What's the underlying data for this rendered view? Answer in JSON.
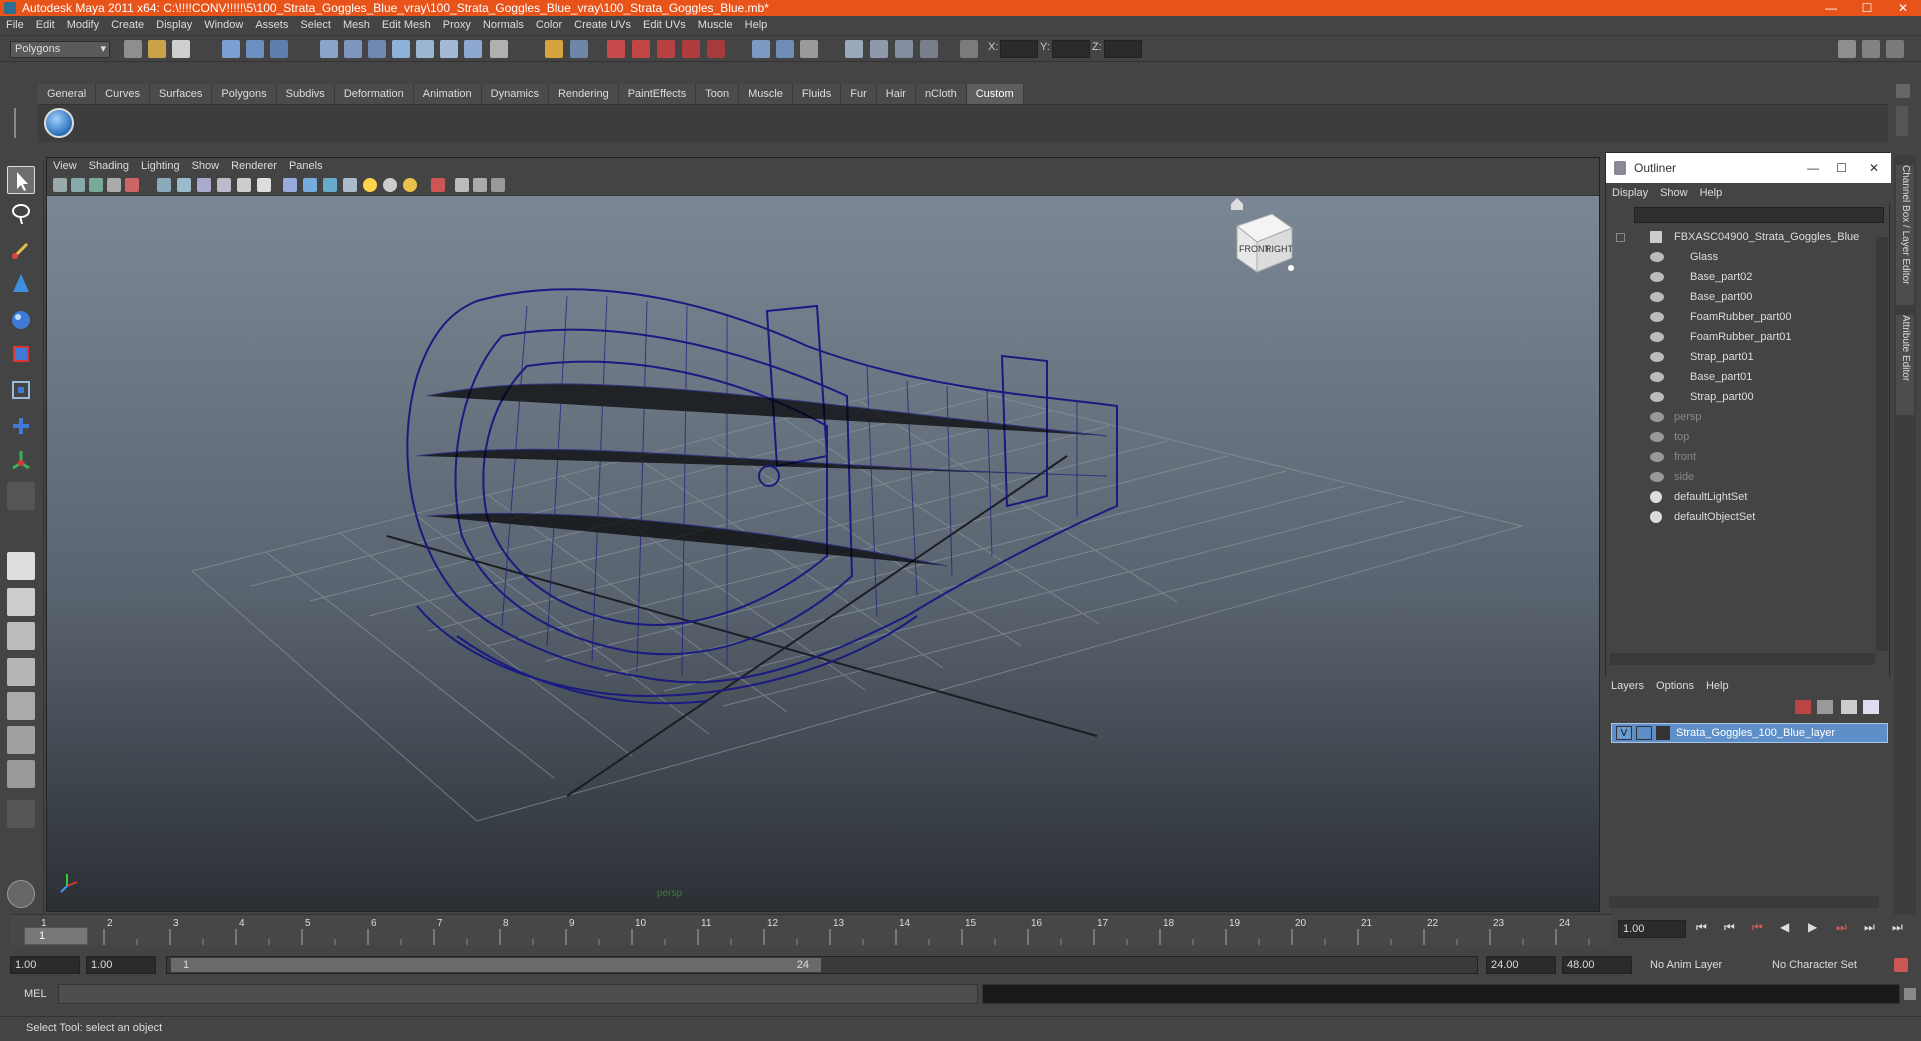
{
  "title": "Autodesk Maya 2011 x64: C:\\!!!!CONV!!!!!\\5\\100_Strata_Goggles_Blue_vray\\100_Strata_Goggles_Blue_vray\\100_Strata_Goggles_Blue.mb*",
  "window_controls": [
    "—",
    "☐",
    "✕"
  ],
  "menubar": [
    "File",
    "Edit",
    "Modify",
    "Create",
    "Display",
    "Window",
    "Assets",
    "Select",
    "Mesh",
    "Edit Mesh",
    "Proxy",
    "Normals",
    "Color",
    "Create UVs",
    "Edit UVs",
    "Muscle",
    "Help"
  ],
  "status_line": {
    "mode": "Polygons",
    "x_label": "X:",
    "y_label": "Y:",
    "z_label": "Z:"
  },
  "shelf_tabs": [
    "General",
    "Curves",
    "Surfaces",
    "Polygons",
    "Subdivs",
    "Deformation",
    "Animation",
    "Dynamics",
    "Rendering",
    "PaintEffects",
    "Toon",
    "Muscle",
    "Fluids",
    "Fur",
    "Hair",
    "nCloth",
    "Custom"
  ],
  "active_shelf": "Custom",
  "viewport_menu": [
    "View",
    "Shading",
    "Lighting",
    "Show",
    "Renderer",
    "Panels"
  ],
  "viewcube": {
    "front": "FRONT",
    "right": "RIGHT"
  },
  "viewport_label": "persp",
  "outliner": {
    "title": "Outliner",
    "menu": [
      "Display",
      "Show",
      "Help"
    ],
    "root": "FBXASC04900_Strata_Goggles_Blue",
    "children": [
      "Glass",
      "Base_part02",
      "Base_part00",
      "FoamRubber_part00",
      "FoamRubber_part01",
      "Strap_part01",
      "Base_part01",
      "Strap_part00"
    ],
    "cameras": [
      "persp",
      "top",
      "front",
      "side"
    ],
    "sets": [
      "defaultLightSet",
      "defaultObjectSet"
    ]
  },
  "layers": {
    "menu": [
      "Layers",
      "Options",
      "Help"
    ],
    "visible_flag": "V",
    "layer_name": "Strata_Goggles_100_Blue_layer"
  },
  "side_tabs": [
    "Channel Box / Layer Editor",
    "Attribute Editor"
  ],
  "timeline": {
    "ticks": [
      "1",
      "2",
      "3",
      "4",
      "5",
      "6",
      "7",
      "8",
      "9",
      "10",
      "11",
      "12",
      "13",
      "14",
      "15",
      "16",
      "17",
      "18",
      "19",
      "20",
      "21",
      "22",
      "23",
      "24"
    ],
    "current_frame_marker": "1",
    "current_time": "1.00"
  },
  "range": {
    "start_time": "1.00",
    "playback_start": "1.00",
    "slider_start": "1",
    "slider_end": "24",
    "playback_end": "24.00",
    "end_time": "48.00",
    "anim_layer": "No Anim Layer",
    "character_set": "No Character Set"
  },
  "command_line": {
    "label": "MEL"
  },
  "help_line": "Select Tool: select an object",
  "colors": {
    "title_bar": "#e8531a",
    "wireframe": "#1a1a80",
    "selected_layer": "#5f8fc9"
  }
}
